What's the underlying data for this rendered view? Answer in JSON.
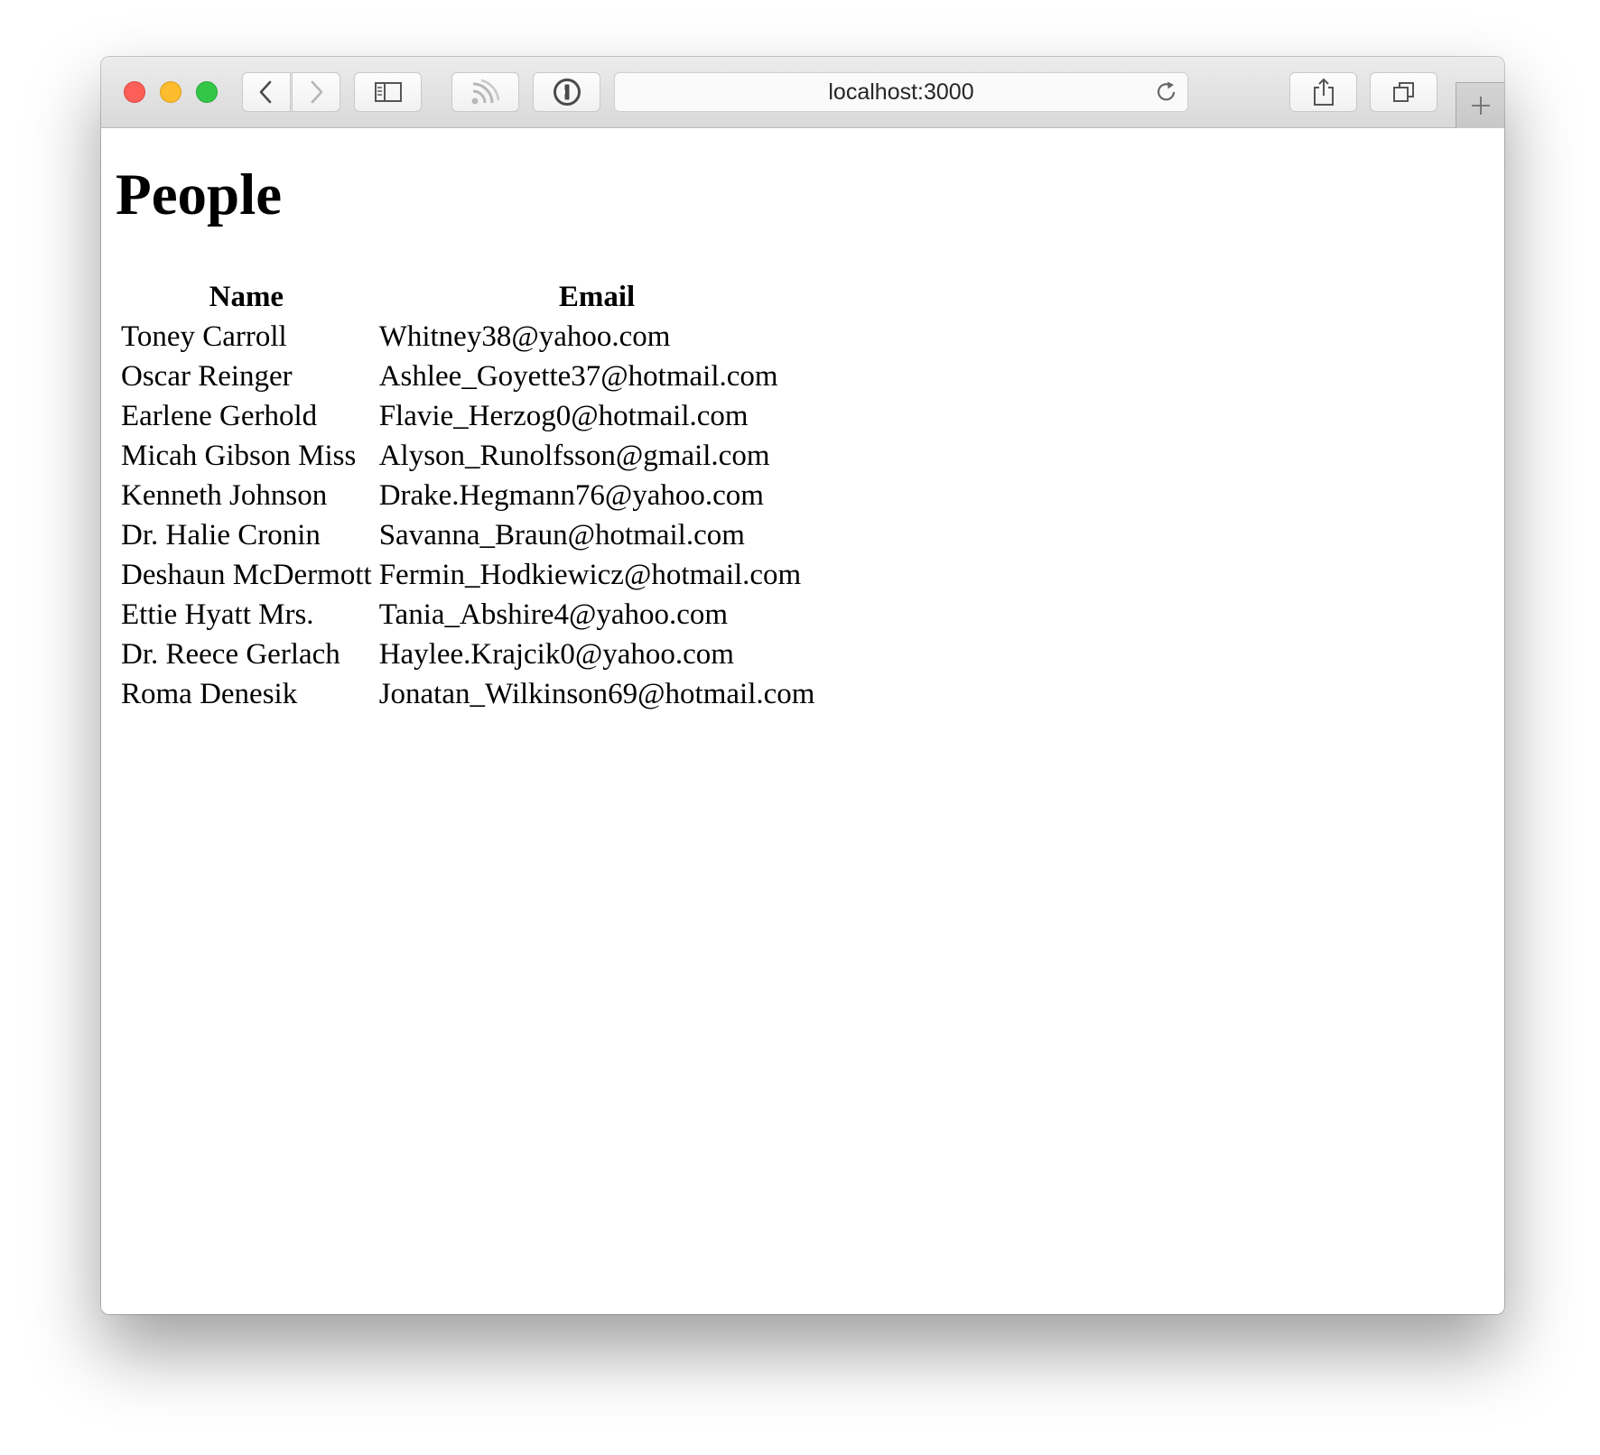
{
  "browser": {
    "url": "localhost:3000",
    "traffic_lights": {
      "close_color": "#fc5f57",
      "minimize_color": "#fdbc2e",
      "maximize_color": "#33c748"
    },
    "toolbar_icons": [
      "chevron-left-icon",
      "chevron-right-icon",
      "sidebar-icon",
      "rss-icon",
      "password-manager-icon",
      "reload-icon",
      "share-icon",
      "tabs-overview-icon",
      "plus-icon"
    ]
  },
  "page": {
    "title": "People",
    "table": {
      "headers": {
        "name": "Name",
        "email": "Email"
      },
      "rows": [
        {
          "name": "Toney Carroll",
          "email": "Whitney38@yahoo.com"
        },
        {
          "name": "Oscar Reinger",
          "email": "Ashlee_Goyette37@hotmail.com"
        },
        {
          "name": "Earlene Gerhold",
          "email": "Flavie_Herzog0@hotmail.com"
        },
        {
          "name": "Micah Gibson Miss",
          "email": "Alyson_Runolfsson@gmail.com"
        },
        {
          "name": "Kenneth Johnson",
          "email": "Drake.Hegmann76@yahoo.com"
        },
        {
          "name": "Dr. Halie Cronin",
          "email": "Savanna_Braun@hotmail.com"
        },
        {
          "name": "Deshaun McDermott",
          "email": "Fermin_Hodkiewicz@hotmail.com"
        },
        {
          "name": "Ettie Hyatt Mrs.",
          "email": "Tania_Abshire4@yahoo.com"
        },
        {
          "name": "Dr. Reece Gerlach",
          "email": "Haylee.Krajcik0@yahoo.com"
        },
        {
          "name": "Roma Denesik",
          "email": "Jonatan_Wilkinson69@hotmail.com"
        }
      ]
    }
  }
}
